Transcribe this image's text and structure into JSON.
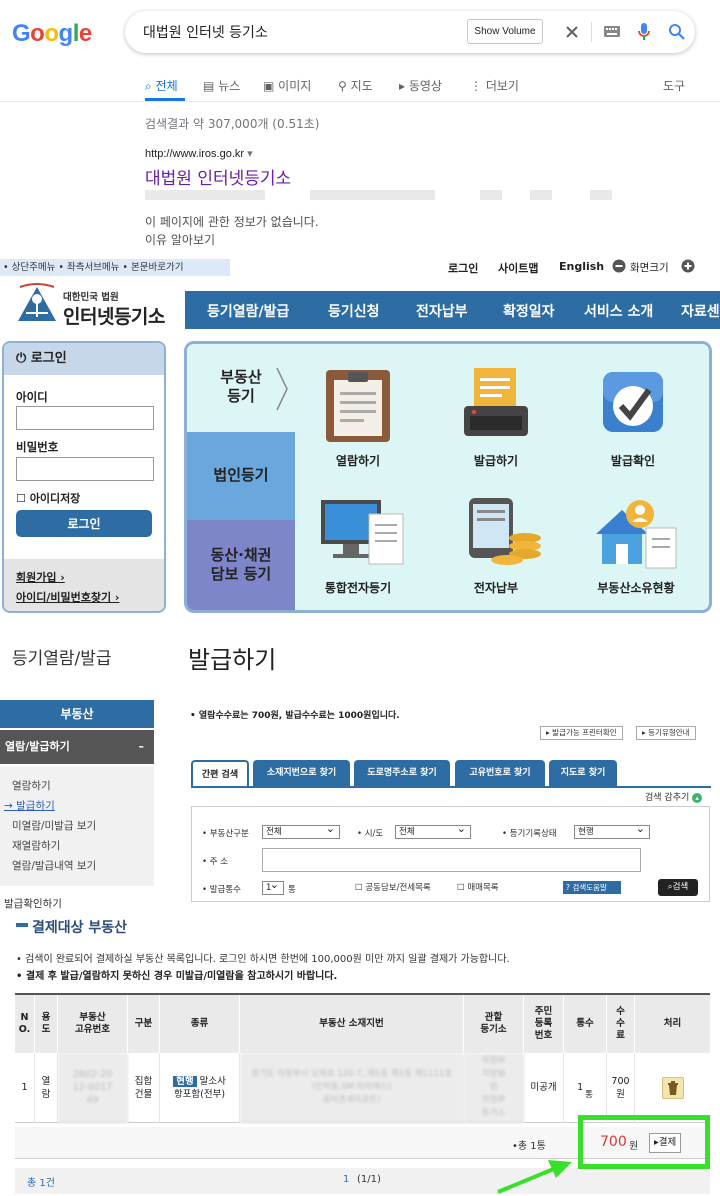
{
  "google": {
    "logo": "Google",
    "query": "대법원 인터넷 등기소",
    "show_volume": "Show Volume",
    "tabs": [
      "전체",
      "뉴스",
      "이미지",
      "지도",
      "동영상",
      "더보기",
      "도구"
    ],
    "result_stats": "검색결과 약 307,000개 (0.51초)",
    "result_url": "http://www.iros.go.kr",
    "result_title": "대법원 인터넷등기소",
    "result_desc": "이 페이지에 관한 정보가 없습니다.",
    "result_link": "이유 알아보기"
  },
  "iros": {
    "skip_links": "• 상단주메뉴 • 좌측서브메뉴 • 본문바로가기",
    "util": {
      "login": "로그인",
      "sitemap": "사이트맵",
      "english": "English",
      "zoom": "화면크기"
    },
    "logo_sub": "대한민국 법원",
    "logo_main": "인터넷등기소",
    "gnb": [
      "등기열람/발급",
      "등기신청",
      "전자납부",
      "확정일자",
      "서비스 소개",
      "자료센"
    ],
    "login": {
      "title": "로그인",
      "id_label": "아이디",
      "pw_label": "비밀번호",
      "save_id": "아이디저장",
      "button": "로그인",
      "join": "회원가입 ›",
      "find": "아이디/비밀번호찾기 ›"
    },
    "quick": {
      "side": [
        "부동산\n등기",
        "법인등기",
        "동산·채권\n담보 등기"
      ],
      "items": [
        "열람하기",
        "발급하기",
        "발급확인",
        "통합전자등기",
        "전자납부",
        "부동산소유현황"
      ]
    },
    "section_left": "등기열람/발급",
    "section_main": "발급하기",
    "left_nav": {
      "head": "부동산",
      "sub": "열람/발급하기",
      "sub_icon": "–",
      "items": [
        "열람하기",
        "→ 발급하기",
        "미열람/미발급 보기",
        "재열람하기",
        "열람/발급내역 보기"
      ],
      "extra": "발급확인하기"
    },
    "fee_notice": "• 열람수수료는 700원, 발급수수료는 1000원입니다.",
    "small_buttons": [
      "▸ 발급가능 프린터확인",
      "▸ 등기유형안내"
    ],
    "search_tabs": [
      "간편 검색",
      "소재지번으로 찾기",
      "도로명주소로 찾기",
      "고유번호로 찾기",
      "지도로 찾기"
    ],
    "search_options": "검색 감추기",
    "form": {
      "type_label": "• 부동산구분",
      "type_value": "전체",
      "sido_label": "• 시/도",
      "sido_value": "전체",
      "status_label": "• 등기기록상태",
      "status_value": "현행",
      "addr_label": "• 주 소",
      "count_label": "• 발급통수",
      "count_value": "1",
      "count_unit": "통",
      "chk1": "공동담보/전세목록",
      "chk2": "매매목록",
      "help": "검색도움말",
      "search": "검색"
    },
    "pay_title": "결제대상 부동산",
    "pay_note1": "• 검색이 완료되어 결제하실 부동산 목록입니다. 로그인 하시면 한번에 100,000원 미만 까지 일괄 결제가 가능합니다.",
    "pay_note2": "• 결제 후 발급/열람하지 못하신 경우 미발급/미열람을 참고하시기 바랍니다.",
    "table": {
      "headers": [
        "N\nO.",
        "용\n도",
        "부동산\n고유번호",
        "구분",
        "종류",
        "부동산 소재지번",
        "관할\n등기소",
        "주민\n등록\n번호",
        "통수",
        "수\n수\n료",
        "처리"
      ],
      "row": {
        "no": "1",
        "use": "열\n람",
        "unique_no": "2802-20\n12-0017\n49",
        "category": "집합\n건물",
        "badge": "현행",
        "kind_a": "말소사",
        "kind_b": "항포함(전부)",
        "address": "경기도 의정부시 오목로 120-7, 제1동 제1동 제1111호 (민락동,SM 미라에스)\n을미관세리조트)",
        "office": "의정부\n지방법\n원\n의정부\n등기소",
        "resident": "미공개",
        "count": "1",
        "count_unit": "통",
        "fee": "700\n원"
      },
      "total_label": "•총 1통",
      "total_price": "700",
      "total_unit": "원",
      "pay_button": "▸결제"
    },
    "pager": {
      "total": "총 1건",
      "page": "1",
      "of": "(1/1)"
    }
  }
}
